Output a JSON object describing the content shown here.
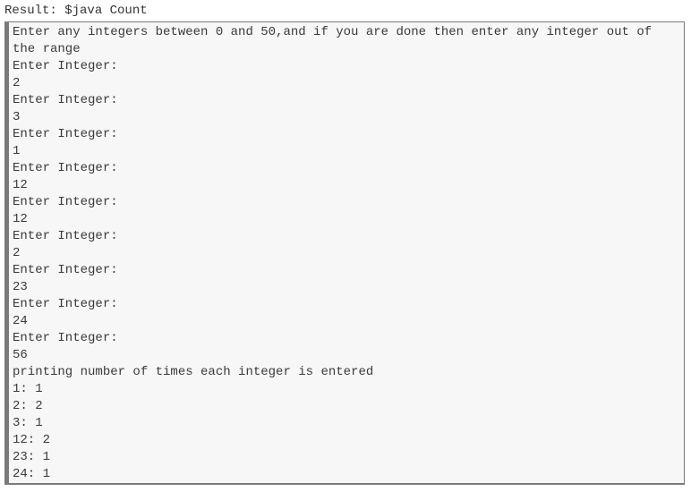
{
  "header": {
    "result_label": "Result: $java Count"
  },
  "output": {
    "lines": [
      "Enter any integers between 0 and 50,and if you are done then enter any integer out of",
      "the range",
      "Enter Integer:",
      "2",
      "Enter Integer:",
      "3",
      "Enter Integer:",
      "1",
      "Enter Integer:",
      "12",
      "Enter Integer:",
      "12",
      "Enter Integer:",
      "2",
      "Enter Integer:",
      "23",
      "Enter Integer:",
      "24",
      "Enter Integer:",
      "56",
      "printing number of times each integer is entered",
      "1: 1",
      "2: 2",
      "3: 1",
      "12: 2",
      "23: 1",
      "24: 1"
    ]
  },
  "colors": {
    "box_background": "#f7f7f7",
    "box_border": "#7a7a7a",
    "text": "#3a3a3a"
  }
}
